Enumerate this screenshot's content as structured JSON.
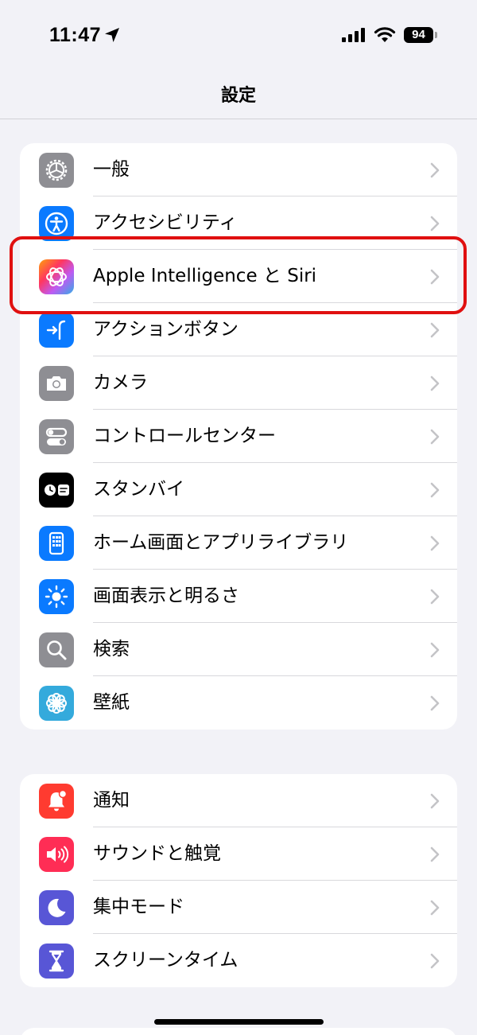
{
  "status_bar": {
    "time": "11:47",
    "battery": "94"
  },
  "header": {
    "title": "設定"
  },
  "group1": {
    "items": [
      {
        "label": "一般",
        "icon": "gear-icon",
        "color": "#8e8e93"
      },
      {
        "label": "アクセシビリティ",
        "icon": "accessibility-icon",
        "color": "#0a7aff"
      },
      {
        "label": "Apple Intelligence と Siri",
        "icon": "apple-intelligence-icon",
        "color": "#ff5c8a"
      },
      {
        "label": "アクションボタン",
        "icon": "action-button-icon",
        "color": "#0a7aff"
      },
      {
        "label": "カメラ",
        "icon": "camera-icon",
        "color": "#8e8e93"
      },
      {
        "label": "コントロールセンター",
        "icon": "control-center-icon",
        "color": "#8e8e93"
      },
      {
        "label": "スタンバイ",
        "icon": "standby-icon",
        "color": "#000000"
      },
      {
        "label": "ホーム画面とアプリライブラリ",
        "icon": "home-screen-icon",
        "color": "#0a7aff"
      },
      {
        "label": "画面表示と明るさ",
        "icon": "brightness-icon",
        "color": "#0a7aff"
      },
      {
        "label": "検索",
        "icon": "search-icon",
        "color": "#8e8e93"
      },
      {
        "label": "壁紙",
        "icon": "wallpaper-icon",
        "color": "#34aadc"
      }
    ]
  },
  "group2": {
    "items": [
      {
        "label": "通知",
        "icon": "notifications-icon",
        "color": "#ff3b30"
      },
      {
        "label": "サウンドと触覚",
        "icon": "sounds-icon",
        "color": "#ff2d55"
      },
      {
        "label": "集中モード",
        "icon": "focus-moon-icon",
        "color": "#5856d6"
      },
      {
        "label": "スクリーンタイム",
        "icon": "hourglass-icon",
        "color": "#5856d6"
      }
    ]
  },
  "annotation": {
    "highlight_color": "#e01010"
  }
}
